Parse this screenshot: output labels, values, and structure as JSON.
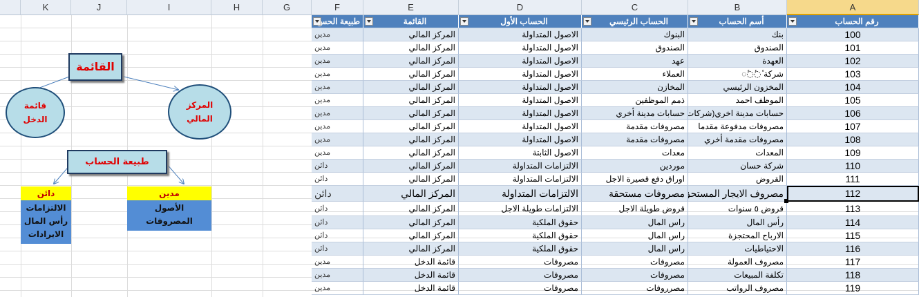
{
  "columns": [
    "K",
    "J",
    "I",
    "H",
    "G",
    "F",
    "E",
    "D",
    "C",
    "B",
    "A"
  ],
  "table": {
    "headers": {
      "A": "رقم الحساب",
      "B": "أسم الحساب",
      "C": "الحساب الرئيسي",
      "D": "الحساب الأول",
      "E": "القائمة",
      "F": "طبيعة الحس"
    },
    "rows": [
      {
        "a": "100",
        "b": "بنك",
        "c": "البنوك",
        "d": "الاصول المتداولة",
        "e": "المركز المالي",
        "f": "مدين"
      },
      {
        "a": "101",
        "b": "الصندوق",
        "c": "الصندوق",
        "d": "الاصول المتداولة",
        "e": "المركز المالي",
        "f": "مدين"
      },
      {
        "a": "102",
        "b": "العهدة",
        "c": "عهد",
        "d": "الاصول المتداولة",
        "e": "المركز المالي",
        "f": "مدين"
      },
      {
        "a": "103",
        "b": "شركة ٔ◌ٔ◌ٔ◌",
        "c": "العملاء",
        "d": "الاصول المتداولة",
        "e": "المركز المالي",
        "f": "مدين"
      },
      {
        "a": "104",
        "b": "المخزون الرئيسي",
        "c": "المخازن",
        "d": "الاصول المتداولة",
        "e": "المركز المالي",
        "f": "مدين"
      },
      {
        "a": "105",
        "b": "الموظف احمد",
        "c": "ذمم الموظفين",
        "d": "الاصول المتداولة",
        "e": "المركز المالي",
        "f": "مدين"
      },
      {
        "a": "106",
        "b": "حسابات مدينة اخري(شركات",
        "c": "حسابات مدينة أخري",
        "d": "الاصول المتداولة",
        "e": "المركز المالي",
        "f": "مدين"
      },
      {
        "a": "107",
        "b": "مصروفات مدفوعة مقدما",
        "c": "مصروفات مقدمة",
        "d": "الاصول المتداولة",
        "e": "المركز المالي",
        "f": "مدين"
      },
      {
        "a": "108",
        "b": "مصروفات مقدمة أخري",
        "c": "مصروفات مقدمة",
        "d": "الاصول المتداولة",
        "e": "المركز المالي",
        "f": "مدين"
      },
      {
        "a": "109",
        "b": "المعدات",
        "c": "معدات",
        "d": "الاصول الثابتة",
        "e": "المركز المالي",
        "f": "مدين"
      },
      {
        "a": "110",
        "b": "شركة حسان",
        "c": "موردين",
        "d": "الالتزامات المتداولة",
        "e": "المركز المالي",
        "f": "دائن"
      },
      {
        "a": "111",
        "b": "القروض",
        "c": "اوراق دفع قصيرة الاجل",
        "d": "الالتزامات المتداولة",
        "e": "المركز المالي",
        "f": "دائن"
      },
      {
        "a": "112",
        "b": "مصروف الايجار المستحق",
        "c": "مصروفات مستحقة",
        "d": "الالتزامات المتداولة",
        "e": "المركز المالي",
        "f": "دائن"
      },
      {
        "a": "113",
        "b": "قروض ٥ سنوات",
        "c": "قروض طويلة الاجل",
        "d": "الالتزامات طويلة الاجل",
        "e": "المركز المالي",
        "f": "دائن"
      },
      {
        "a": "114",
        "b": "رأس المال",
        "c": "راس المال",
        "d": "حقوق الملكية",
        "e": "المركز المالي",
        "f": "دائن"
      },
      {
        "a": "115",
        "b": "الارباح المحتجزة",
        "c": "راس المال",
        "d": "حقوق الملكية",
        "e": "المركز المالي",
        "f": "دائن"
      },
      {
        "a": "116",
        "b": "الاحتياطيات",
        "c": "راس المال",
        "d": "حقوق الملكية",
        "e": "المركز المالي",
        "f": "دائن"
      },
      {
        "a": "117",
        "b": "مصروف العمولة",
        "c": "مصروفات",
        "d": "مصروفات",
        "e": "قائمة الدخل",
        "f": "مدين"
      },
      {
        "a": "118",
        "b": "تكلفة المبيعات",
        "c": "مصروفات",
        "d": "مصروفات",
        "e": "قائمة الدخل",
        "f": "مدين"
      },
      {
        "a": "119",
        "b": "مصروف الرواتب",
        "c": "مصرروفات",
        "d": "مصروفات",
        "e": "قائمة الدخل",
        "f": "مدين"
      }
    ]
  },
  "diagram": {
    "top_box": "القائمة",
    "left_ellipse_line1": "قائمة",
    "left_ellipse_line2": "الدخل",
    "right_ellipse_line1": "المركز",
    "right_ellipse_line2": "المالي",
    "nature_box": "طبيعة الحساب",
    "credit_title": "دائن",
    "credit_items": [
      "الالتزامات",
      "رأس المال",
      "الايرادات"
    ],
    "debit_title": "مدين",
    "debit_items": [
      "الأصول",
      "المصروفات"
    ]
  }
}
